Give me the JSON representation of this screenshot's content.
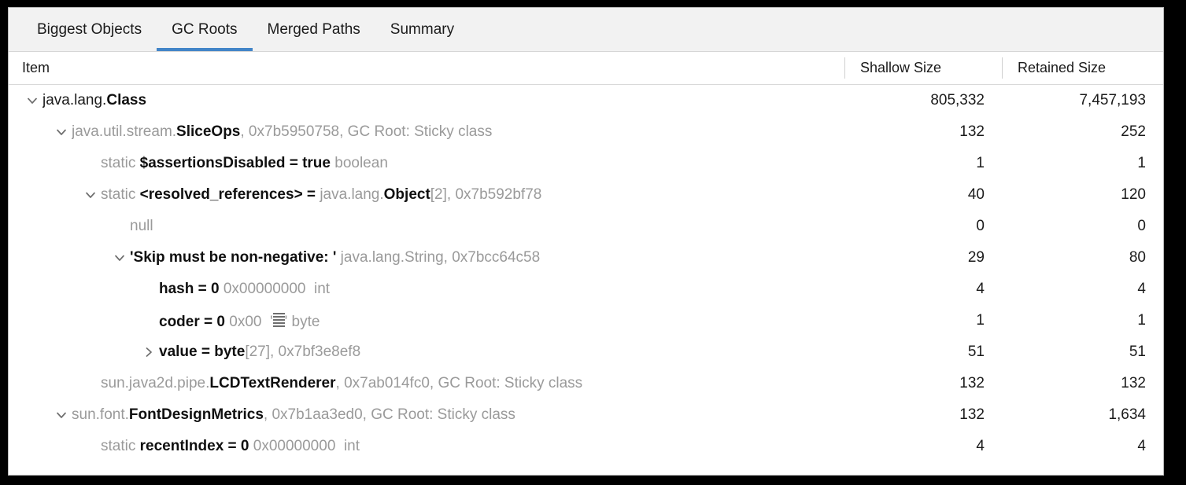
{
  "window": {
    "frame_color": "#000000",
    "panel_bg": "#ffffff"
  },
  "tabs": {
    "accent_color": "#4285c8",
    "active": "GC Roots",
    "items": [
      {
        "label": "Biggest Objects",
        "active": false
      },
      {
        "label": "GC Roots",
        "active": true
      },
      {
        "label": "Merged Paths",
        "active": false
      },
      {
        "label": "Summary",
        "active": false
      }
    ]
  },
  "table": {
    "columns": [
      {
        "label": "Item",
        "align": "left"
      },
      {
        "label": "Shallow Size",
        "align": "right"
      },
      {
        "label": "Retained Size",
        "align": "right"
      }
    ],
    "colors": {
      "text": "#1b1b1b",
      "dim_text": "#9a9a9a",
      "header_bg": "#f2f2f2",
      "grid": "#d9d9d9"
    },
    "rows": [
      {
        "depth": 0,
        "twisty": "chevron-down-icon",
        "segments": [
          {
            "text": "java.lang.",
            "style": "plain"
          },
          {
            "text": "Class",
            "style": "bold"
          }
        ],
        "shallow_size": "805,332",
        "retained_size": "7,457,193"
      },
      {
        "depth": 1,
        "twisty": "chevron-down-icon",
        "segments": [
          {
            "text": "java.util.stream.",
            "style": "dim"
          },
          {
            "text": "SliceOps",
            "style": "bold"
          },
          {
            "text": ", 0x7b5950758, GC Root: Sticky class",
            "style": "dim"
          }
        ],
        "shallow_size": "132",
        "retained_size": "252"
      },
      {
        "depth": 2,
        "twisty": "none",
        "segments": [
          {
            "text": "static ",
            "style": "dim"
          },
          {
            "text": "$assertionsDisabled = true",
            "style": "bold"
          },
          {
            "text": " boolean",
            "style": "dim"
          }
        ],
        "shallow_size": "1",
        "retained_size": "1"
      },
      {
        "depth": 2,
        "twisty": "chevron-down-icon",
        "segments": [
          {
            "text": "static ",
            "style": "dim"
          },
          {
            "text": "<resolved_references> = ",
            "style": "bold"
          },
          {
            "text": "java.lang.",
            "style": "dim"
          },
          {
            "text": "Object",
            "style": "bold"
          },
          {
            "text": "[2], 0x7b592bf78",
            "style": "dim"
          }
        ],
        "shallow_size": "40",
        "retained_size": "120"
      },
      {
        "depth": 3,
        "twisty": "none",
        "segments": [
          {
            "text": "null",
            "style": "dim"
          }
        ],
        "shallow_size": "0",
        "retained_size": "0"
      },
      {
        "depth": 3,
        "twisty": "chevron-down-icon",
        "segments": [
          {
            "text": "'Skip must be non-negative: '",
            "style": "bold"
          },
          {
            "text": " java.lang.String, 0x7bcc64c58",
            "style": "dim"
          }
        ],
        "shallow_size": "29",
        "retained_size": "80"
      },
      {
        "depth": 4,
        "twisty": "none",
        "segments": [
          {
            "text": "hash = 0",
            "style": "bold"
          },
          {
            "text": " 0x00000000  int",
            "style": "dim"
          }
        ],
        "shallow_size": "4",
        "retained_size": "4"
      },
      {
        "depth": 4,
        "twisty": "none",
        "segments": [
          {
            "text": "coder = 0",
            "style": "bold"
          },
          {
            "text": " 0x00  '",
            "style": "dim"
          },
          {
            "text": "",
            "style": "nul-glyph"
          },
          {
            "text": "' byte",
            "style": "dim"
          }
        ],
        "shallow_size": "1",
        "retained_size": "1"
      },
      {
        "depth": 4,
        "twisty": "chevron-right-icon",
        "segments": [
          {
            "text": "value = byte",
            "style": "bold"
          },
          {
            "text": "[27], 0x7bf3e8ef8",
            "style": "dim"
          }
        ],
        "shallow_size": "51",
        "retained_size": "51"
      },
      {
        "depth": 2,
        "twisty": "none",
        "segments": [
          {
            "text": "sun.java2d.pipe.",
            "style": "dim"
          },
          {
            "text": "LCDTextRenderer",
            "style": "bold"
          },
          {
            "text": ", 0x7ab014fc0, GC Root: Sticky class",
            "style": "dim"
          }
        ],
        "shallow_size": "132",
        "retained_size": "132"
      },
      {
        "depth": 1,
        "twisty": "chevron-down-icon",
        "segments": [
          {
            "text": "sun.font.",
            "style": "dim"
          },
          {
            "text": "FontDesignMetrics",
            "style": "bold"
          },
          {
            "text": ", 0x7b1aa3ed0, GC Root: Sticky class",
            "style": "dim"
          }
        ],
        "shallow_size": "132",
        "retained_size": "1,634"
      },
      {
        "depth": 2,
        "twisty": "none",
        "segments": [
          {
            "text": "static ",
            "style": "dim"
          },
          {
            "text": "recentIndex = 0",
            "style": "bold"
          },
          {
            "text": " 0x00000000  int",
            "style": "dim"
          }
        ],
        "shallow_size": "4",
        "retained_size": "4"
      }
    ]
  }
}
